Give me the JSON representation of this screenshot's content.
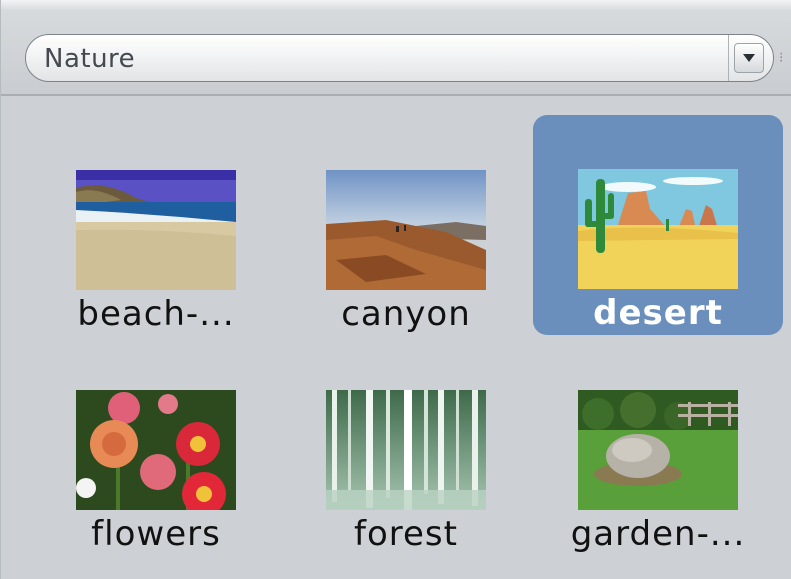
{
  "category_select": {
    "value": "Nature"
  },
  "gallery": {
    "items": [
      {
        "label": "beach-...",
        "thumbnail": "beach-thumbnail",
        "selected": false
      },
      {
        "label": "canyon",
        "thumbnail": "canyon-thumbnail",
        "selected": false
      },
      {
        "label": "desert",
        "thumbnail": "desert-thumbnail",
        "selected": true
      },
      {
        "label": "flowers",
        "thumbnail": "flowers-thumbnail",
        "selected": false
      },
      {
        "label": "forest",
        "thumbnail": "forest-thumbnail",
        "selected": false
      },
      {
        "label": "garden-...",
        "thumbnail": "garden-thumbnail",
        "selected": false
      }
    ]
  },
  "colors": {
    "panel": "#cdd1d5",
    "selection": "#6a8fbd"
  }
}
